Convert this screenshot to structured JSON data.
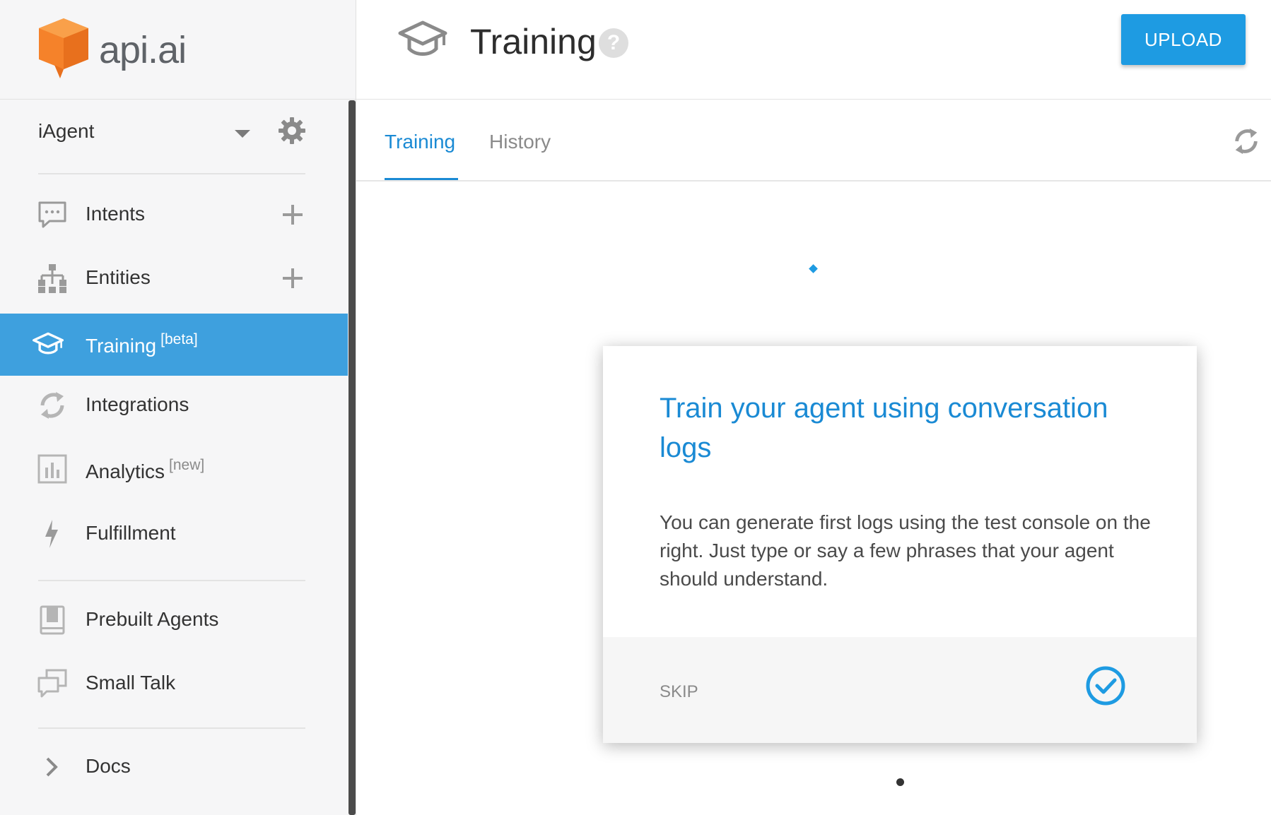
{
  "brand": {
    "name": "api.ai",
    "accent": "#f5822a"
  },
  "sidebar": {
    "agent": "iAgent",
    "items": [
      {
        "label": "Intents",
        "sup": "",
        "icon": "chat-icon",
        "has_add": true
      },
      {
        "label": "Entities",
        "sup": "",
        "icon": "hierarchy-icon",
        "has_add": true
      },
      {
        "label": "Training",
        "sup": "[beta]",
        "icon": "graduation-cap-icon",
        "active": true
      },
      {
        "label": "Integrations",
        "sup": "",
        "icon": "sync-icon"
      },
      {
        "label": "Analytics",
        "sup": "[new]",
        "icon": "bar-chart-icon"
      },
      {
        "label": "Fulfillment",
        "sup": "",
        "icon": "lightning-icon"
      },
      {
        "label": "Prebuilt Agents",
        "sup": "",
        "icon": "book-icon"
      },
      {
        "label": "Small Talk",
        "sup": "",
        "icon": "dialog-icon"
      },
      {
        "label": "Docs",
        "sup": "",
        "icon": "chevron-right-icon"
      }
    ]
  },
  "header": {
    "title": "Training",
    "help": "?",
    "upload_label": "UPLOAD"
  },
  "tabs": [
    {
      "label": "Training",
      "active": true
    },
    {
      "label": "History"
    }
  ],
  "card": {
    "title": "Train your agent using conversation logs",
    "body": "You can generate first logs using the test console on the right. Just type or say a few phrases that your agent should understand.",
    "skip_label": "SKIP"
  },
  "colors": {
    "primary": "#1e9be2",
    "active_nav": "#3ea0de",
    "link": "#1a8ad4"
  }
}
